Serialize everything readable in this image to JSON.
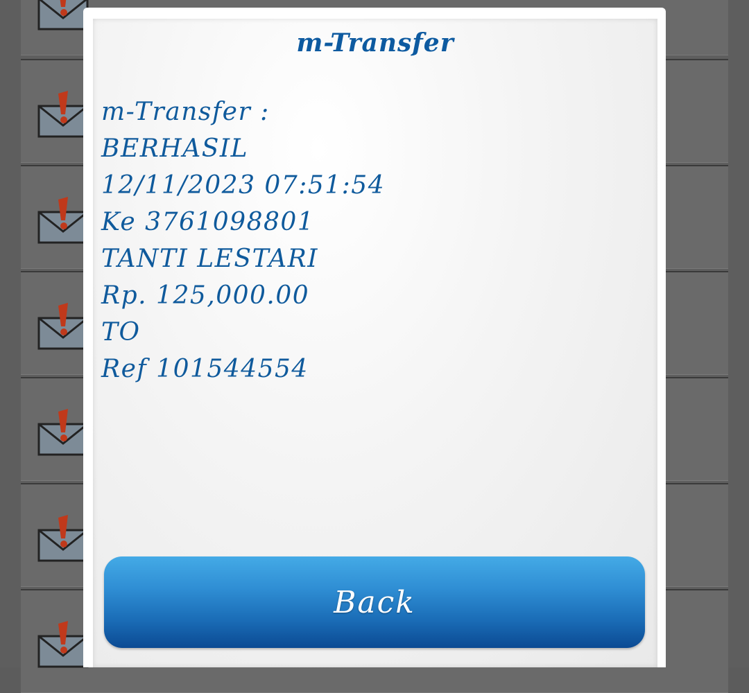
{
  "dialog": {
    "title": "m-Transfer",
    "lines": [
      "m-Transfer :",
      "BERHASIL",
      "12/11/2023 07:51:54",
      "Ke 3761098801",
      "TANTI LESTARI",
      "Rp. 125,000.00",
      "TO",
      "Ref 101544554"
    ],
    "back_label": "Back"
  },
  "background": {
    "row_icon": "mail-warning-icon"
  },
  "colors": {
    "text": "#0f5a9c",
    "button_top": "#44aae6",
    "button_bottom": "#0b4a93"
  }
}
